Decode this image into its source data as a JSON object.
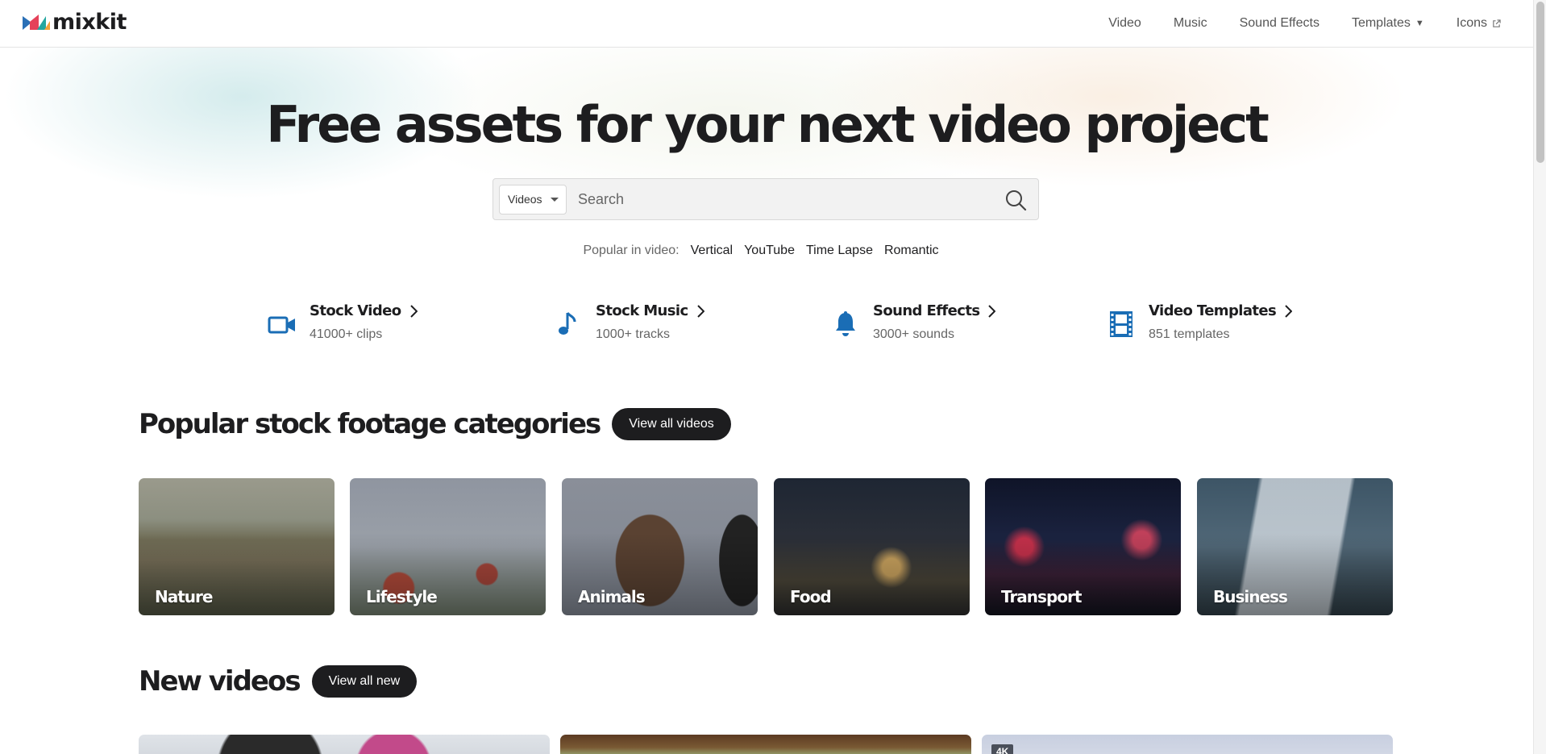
{
  "header": {
    "logo_text": "mixkit",
    "nav": [
      {
        "label": "Video"
      },
      {
        "label": "Music"
      },
      {
        "label": "Sound Effects"
      },
      {
        "label": "Templates"
      },
      {
        "label": "Icons"
      }
    ]
  },
  "hero": {
    "title": "Free assets for your next video project",
    "search": {
      "type_selected": "Videos",
      "placeholder": "Search"
    },
    "popular_label": "Popular in video:",
    "popular_tags": [
      "Vertical",
      "YouTube",
      "Time Lapse",
      "Romantic"
    ]
  },
  "categories": [
    {
      "title": "Stock Video",
      "subtitle": "41000+ clips",
      "icon": "video-camera-icon"
    },
    {
      "title": "Stock Music",
      "subtitle": "1000+ tracks",
      "icon": "music-note-icon"
    },
    {
      "title": "Sound Effects",
      "subtitle": "3000+ sounds",
      "icon": "bell-icon"
    },
    {
      "title": "Video Templates",
      "subtitle": "851 templates",
      "icon": "film-strip-icon"
    }
  ],
  "footage_section": {
    "title": "Popular stock footage categories",
    "button": "View all videos",
    "tiles": [
      "Nature",
      "Lifestyle",
      "Animals",
      "Food",
      "Transport",
      "Business"
    ]
  },
  "new_section": {
    "title": "New videos",
    "button": "View all new",
    "badge": "4K"
  },
  "colors": {
    "accent_blue": "#1a6db5",
    "dark": "#1d1d1f",
    "muted_text": "#666666"
  }
}
